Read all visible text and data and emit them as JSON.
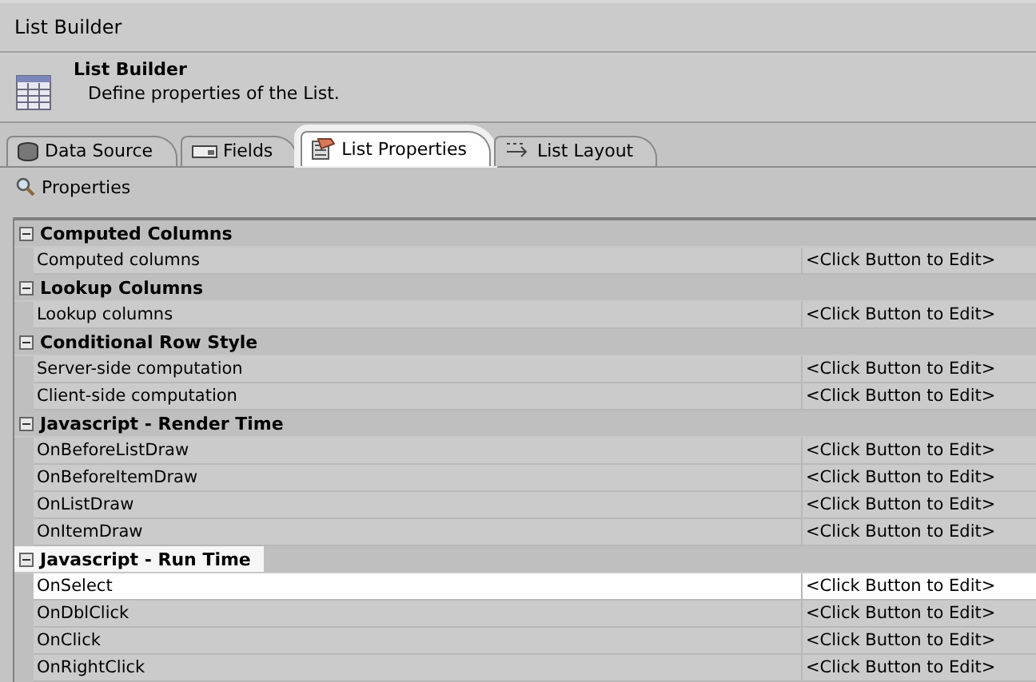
{
  "window": {
    "title": "List Builder"
  },
  "header": {
    "title": "List Builder",
    "subtitle": "Define properties of the List."
  },
  "tabs": [
    {
      "label": "Data Source",
      "kind": "database",
      "selected": false
    },
    {
      "label": "Fields",
      "kind": "field",
      "selected": false
    },
    {
      "label": "List Properties",
      "kind": "properties",
      "selected": true
    },
    {
      "label": "List Layout",
      "kind": "layout",
      "selected": false
    }
  ],
  "toolbar": {
    "label": "Properties"
  },
  "categories": [
    {
      "title": "Computed Columns",
      "expanded": true,
      "highlighted": false,
      "properties": [
        {
          "name": "Computed columns",
          "value": "<Click Button to Edit>",
          "selected": false
        }
      ]
    },
    {
      "title": "Lookup Columns",
      "expanded": true,
      "highlighted": false,
      "properties": [
        {
          "name": "Lookup columns",
          "value": "<Click Button to Edit>",
          "selected": false
        }
      ]
    },
    {
      "title": "Conditional Row Style",
      "expanded": true,
      "highlighted": false,
      "properties": [
        {
          "name": "Server-side computation",
          "value": "<Click Button to Edit>",
          "selected": false
        },
        {
          "name": "Client-side computation",
          "value": "<Click Button to Edit>",
          "selected": false
        }
      ]
    },
    {
      "title": "Javascript - Render Time",
      "expanded": true,
      "highlighted": false,
      "properties": [
        {
          "name": "OnBeforeListDraw",
          "value": "<Click Button to Edit>",
          "selected": false
        },
        {
          "name": "OnBeforeItemDraw",
          "value": "<Click Button to Edit>",
          "selected": false
        },
        {
          "name": "OnListDraw",
          "value": "<Click Button to Edit>",
          "selected": false
        },
        {
          "name": "OnItemDraw",
          "value": "<Click Button to Edit>",
          "selected": false
        }
      ]
    },
    {
      "title": "Javascript - Run Time",
      "expanded": true,
      "highlighted": true,
      "properties": [
        {
          "name": "OnSelect",
          "value": "<Click Button to Edit>",
          "selected": true
        },
        {
          "name": "OnDblClick",
          "value": "<Click Button to Edit>",
          "selected": false
        },
        {
          "name": "OnClick",
          "value": "<Click Button to Edit>",
          "selected": false
        },
        {
          "name": "OnRightClick",
          "value": "<Click Button to Edit>",
          "selected": false
        }
      ]
    }
  ]
}
